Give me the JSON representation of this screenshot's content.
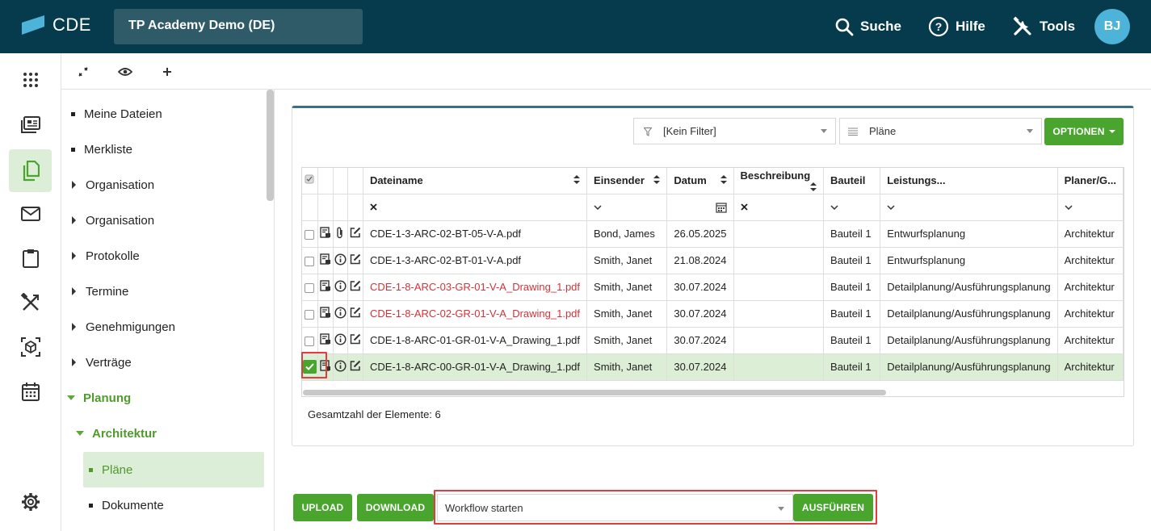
{
  "header": {
    "logo_text": "CDE",
    "project": "TP Academy Demo (DE)",
    "search_label": "Suche",
    "help_label": "Hilfe",
    "tools_label": "Tools",
    "avatar_initials": "BJ"
  },
  "rail": [
    "apps-grid-icon",
    "news-icon",
    "documents-icon",
    "mail-icon",
    "clipboard-icon",
    "tools-icon",
    "model-3d-icon",
    "calendar-icon",
    "settings-icon"
  ],
  "tree": {
    "items": [
      {
        "label": "Meine Dateien",
        "type": "leaf"
      },
      {
        "label": "Merkliste",
        "type": "leaf"
      },
      {
        "label": "Organisation",
        "type": "collapsed"
      },
      {
        "label": "Organisation",
        "type": "collapsed"
      },
      {
        "label": "Protokolle",
        "type": "collapsed"
      },
      {
        "label": "Termine",
        "type": "collapsed"
      },
      {
        "label": "Genehmigungen",
        "type": "collapsed"
      },
      {
        "label": "Verträge",
        "type": "collapsed"
      },
      {
        "label": "Planung",
        "type": "expanded"
      },
      {
        "label": "Architektur",
        "type": "expanded"
      },
      {
        "label": "Pläne",
        "type": "selected"
      },
      {
        "label": "Dokumente",
        "type": "leaf"
      }
    ]
  },
  "filters": {
    "filter_value": "[Kein Filter]",
    "view_value": "Pläne",
    "options_label": "OPTIONEN"
  },
  "table": {
    "columns": [
      "Dateiname",
      "Einsender",
      "Datum",
      "Beschreibung",
      "Bauteil",
      "Leistungs...",
      "Planer/G..."
    ],
    "rows": [
      {
        "file": "CDE-1-3-ARC-02-BT-05-V-A.pdf",
        "sender": "Bond, James",
        "date": "26.05.2025",
        "desc": "",
        "part": "Bauteil 1",
        "phase": "Entwurfsplanung",
        "planner": "Architektur",
        "checked": false,
        "attach": true,
        "red": false
      },
      {
        "file": "CDE-1-3-ARC-02-BT-01-V-A.pdf",
        "sender": "Smith, Janet",
        "date": "21.08.2024",
        "desc": "",
        "part": "Bauteil 1",
        "phase": "Entwurfsplanung",
        "planner": "Architektur",
        "checked": false,
        "attach": false,
        "red": false
      },
      {
        "file": "CDE-1-8-ARC-03-GR-01-V-A_Drawing_1.pdf",
        "sender": "Smith, Janet",
        "date": "30.07.2024",
        "desc": "",
        "part": "Bauteil 1",
        "phase": "Detailplanung/Ausführungsplanung",
        "planner": "Architektur",
        "checked": false,
        "attach": false,
        "red": true
      },
      {
        "file": "CDE-1-8-ARC-02-GR-01-V-A_Drawing_1.pdf",
        "sender": "Smith, Janet",
        "date": "30.07.2024",
        "desc": "",
        "part": "Bauteil 1",
        "phase": "Detailplanung/Ausführungsplanung",
        "planner": "Architektur",
        "checked": false,
        "attach": false,
        "red": true
      },
      {
        "file": "CDE-1-8-ARC-01-GR-01-V-A_Drawing_1.pdf",
        "sender": "Smith, Janet",
        "date": "30.07.2024",
        "desc": "",
        "part": "Bauteil 1",
        "phase": "Detailplanung/Ausführungsplanung",
        "planner": "Architektur",
        "checked": false,
        "attach": false,
        "red": false
      },
      {
        "file": "CDE-1-8-ARC-00-GR-01-V-A_Drawing_1.pdf",
        "sender": "Smith, Janet",
        "date": "30.07.2024",
        "desc": "",
        "part": "Bauteil 1",
        "phase": "Detailplanung/Ausführungsplanung",
        "planner": "Architektur",
        "checked": true,
        "attach": false,
        "red": false
      }
    ]
  },
  "footer": {
    "count_text": "Gesamtzahl der Elemente: 6",
    "upload_label": "UPLOAD",
    "download_label": "DOWNLOAD",
    "workflow_value": "Workflow starten",
    "execute_label": "AUSFÜHREN"
  },
  "colors": {
    "topbar": "#053b4c",
    "accent": "#4aa52f",
    "highlight": "#e23c3c",
    "selected_row": "#ddeed7"
  }
}
